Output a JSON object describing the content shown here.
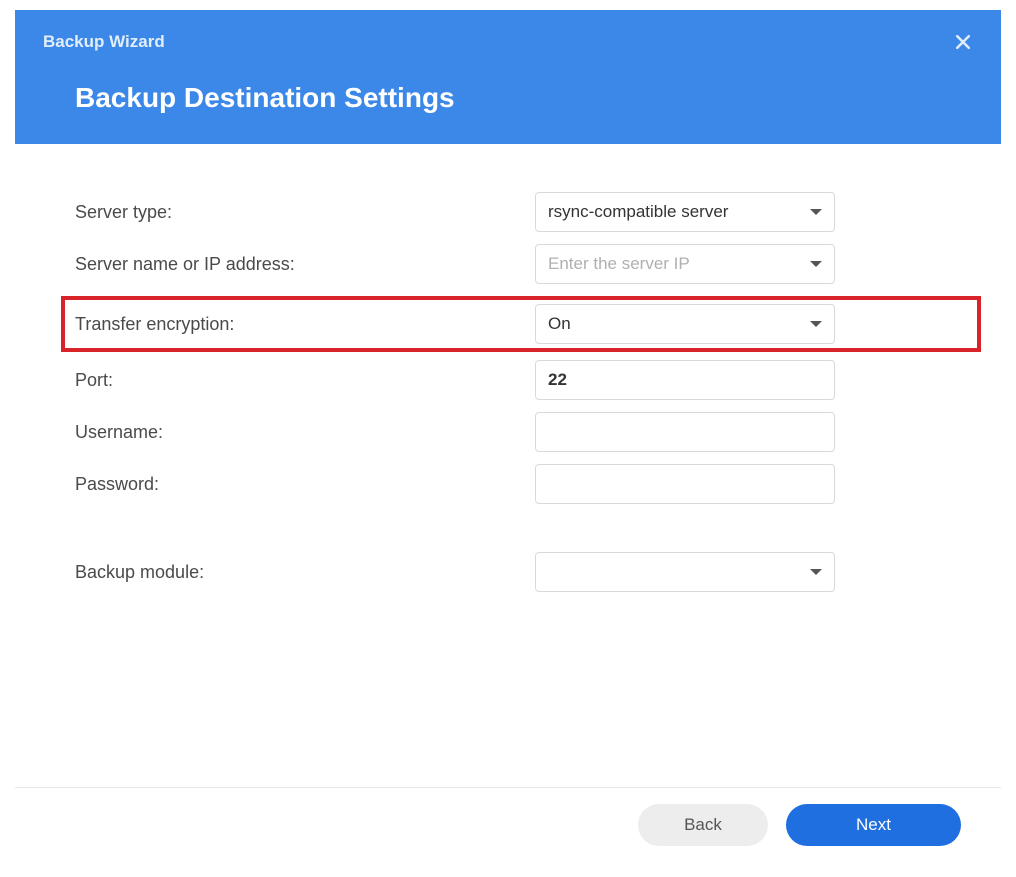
{
  "wizard": {
    "title": "Backup Wizard",
    "page_title": "Backup Destination Settings"
  },
  "form": {
    "server_type": {
      "label": "Server type:",
      "value": "rsync-compatible server"
    },
    "server_ip": {
      "label": "Server name or IP address:",
      "placeholder": "Enter the server IP",
      "value": ""
    },
    "transfer_encryption": {
      "label": "Transfer encryption:",
      "value": "On"
    },
    "port": {
      "label": "Port:",
      "value": "22"
    },
    "username": {
      "label": "Username:",
      "value": ""
    },
    "password": {
      "label": "Password:",
      "value": ""
    },
    "backup_module": {
      "label": "Backup module:",
      "value": ""
    }
  },
  "buttons": {
    "back": "Back",
    "next": "Next"
  }
}
